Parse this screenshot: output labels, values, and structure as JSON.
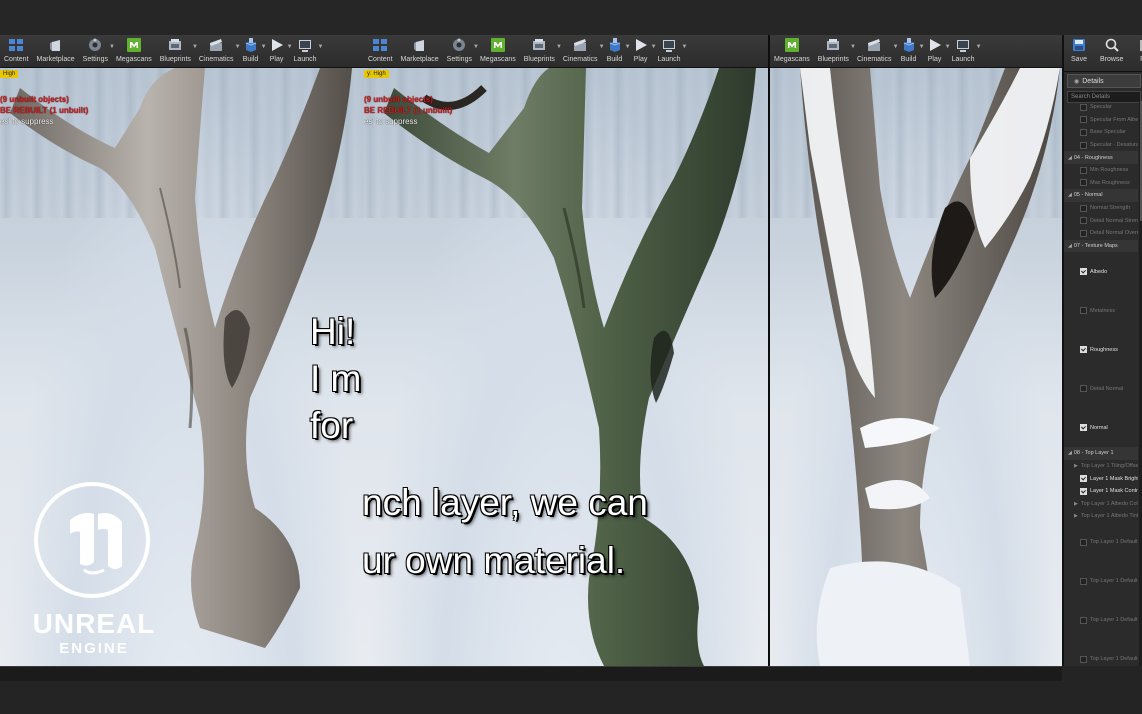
{
  "toolbars": {
    "left": [
      {
        "label": "Content",
        "icon": "content-icon"
      },
      {
        "label": "Marketplace",
        "icon": "marketplace-icon"
      },
      {
        "label": "Settings",
        "icon": "settings-icon"
      },
      {
        "label": "Megascans",
        "icon": "megascans-icon"
      },
      {
        "label": "Blueprints",
        "icon": "blueprints-icon"
      },
      {
        "label": "Cinematics",
        "icon": "cinematics-icon"
      },
      {
        "label": "Build",
        "icon": "build-icon"
      },
      {
        "label": "Play",
        "icon": "play-icon"
      },
      {
        "label": "Launch",
        "icon": "launch-icon"
      }
    ],
    "mid": [
      {
        "label": "Content",
        "icon": "content-icon"
      },
      {
        "label": "Marketplace",
        "icon": "marketplace-icon"
      },
      {
        "label": "Settings",
        "icon": "settings-icon"
      },
      {
        "label": "Megascans",
        "icon": "megascans-icon"
      },
      {
        "label": "Blueprints",
        "icon": "blueprints-icon"
      },
      {
        "label": "Cinematics",
        "icon": "cinematics-icon"
      },
      {
        "label": "Build",
        "icon": "build-icon"
      },
      {
        "label": "Play",
        "icon": "play-icon"
      },
      {
        "label": "Launch",
        "icon": "launch-icon"
      }
    ],
    "right": [
      {
        "label": "Megascans",
        "icon": "megascans-icon"
      },
      {
        "label": "Blueprints",
        "icon": "blueprints-icon"
      },
      {
        "label": "Cinematics",
        "icon": "cinematics-icon"
      },
      {
        "label": "Build",
        "icon": "build-icon"
      },
      {
        "label": "Play",
        "icon": "play-icon"
      },
      {
        "label": "Launch",
        "icon": "launch-icon"
      }
    ]
  },
  "viewport": {
    "left": {
      "badge": "High",
      "warn1": "(9 unbuilt objects)",
      "warn2": "BE REBUILT (1 unbuilt)",
      "warn3": "es' to suppress"
    },
    "mid": {
      "badge": "y: High",
      "warn1": "(9 unbuilt objects)",
      "warn2": "BE REBUILT (1 unbuilt)",
      "warn3": "es' to suppress"
    }
  },
  "subtitles": {
    "left_lines": [
      "Hi!",
      "I m",
      "for"
    ],
    "mid_lines": [
      "nch layer, we can",
      "ur own material."
    ]
  },
  "logo": {
    "line1": "UNREAL",
    "line2": "ENGINE"
  },
  "details": {
    "toolbar": [
      {
        "label": "Save",
        "icon": "save-icon"
      },
      {
        "label": "Browse",
        "icon": "browse-icon"
      },
      {
        "label": "Pa",
        "icon": "paste-icon"
      }
    ],
    "tab_label": "Details",
    "search_placeholder": "Search Details",
    "rows": [
      {
        "type": "item",
        "label": "Specular",
        "checked": false
      },
      {
        "type": "item",
        "label": "Specular From Albedo",
        "checked": false
      },
      {
        "type": "item",
        "label": "Base Specular",
        "checked": false
      },
      {
        "type": "item",
        "label": "Specular - Desaturation",
        "checked": false
      },
      {
        "type": "cat",
        "label": "04 - Roughness"
      },
      {
        "type": "item",
        "label": "Min Roughness",
        "checked": false
      },
      {
        "type": "item",
        "label": "Max Roughness",
        "checked": false
      },
      {
        "type": "cat",
        "label": "05 - Normal"
      },
      {
        "type": "item",
        "label": "Normal Strength",
        "checked": false
      },
      {
        "type": "item",
        "label": "Detail Normal Strength",
        "checked": false
      },
      {
        "type": "item",
        "label": "Detail Normal Override",
        "checked": false
      },
      {
        "type": "cat",
        "label": "07 - Texture Maps"
      },
      {
        "type": "tall",
        "label": "Albedo",
        "checked": true
      },
      {
        "type": "tall",
        "label": "Metalness",
        "checked": false
      },
      {
        "type": "tall",
        "label": "Roughness",
        "checked": true
      },
      {
        "type": "tall",
        "label": "Detail Normal",
        "checked": false
      },
      {
        "type": "tall",
        "label": "Normal",
        "checked": true
      },
      {
        "type": "cat",
        "label": "08 - Top Layer 1"
      },
      {
        "type": "sub",
        "label": "Top Layer 1 Tiling/Offset"
      },
      {
        "type": "item",
        "label": "Layer 1 Mask Brightness",
        "checked": true
      },
      {
        "type": "item",
        "label": "Layer 1 Mask Contrast",
        "checked": true
      },
      {
        "type": "sub",
        "label": "Top Layer 1 Albedo Color"
      },
      {
        "type": "sub",
        "label": "Top Layer 1 Albedo Tint"
      },
      {
        "type": "tall",
        "label": "Top Layer 1 Default Albedo",
        "checked": false
      },
      {
        "type": "tall",
        "label": "Top Layer 1 Default Mask",
        "checked": false
      },
      {
        "type": "tall",
        "label": "Top Layer 1 Default Normal",
        "checked": false
      },
      {
        "type": "tall",
        "label": "Top Layer 1 Default Roughness",
        "checked": false
      }
    ]
  },
  "colors": {
    "accent": "#e8c700",
    "warning": "#d21b1b",
    "megascans": "#5fb12f"
  }
}
